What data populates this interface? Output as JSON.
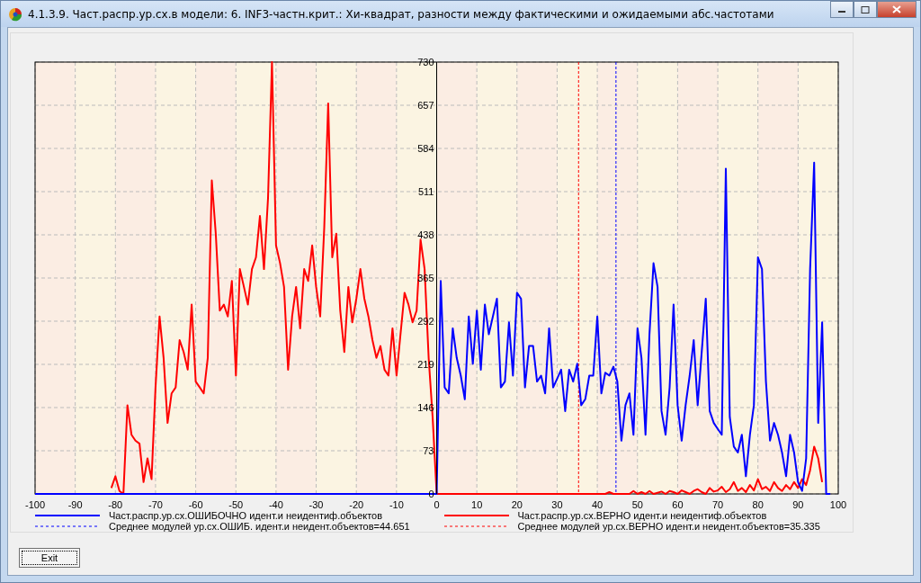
{
  "window": {
    "title": "4.1.3.9. Част.распр.ур.сх.в модели: 6. INF3-частн.крит.: Хи-квадрат, разности между фактическими и ожидаемыми абс.частотами"
  },
  "chart_data": {
    "type": "line",
    "xlim": [
      -100,
      100
    ],
    "ylim": [
      0,
      730
    ],
    "xticks": [
      -100,
      -90,
      -80,
      -70,
      -60,
      -50,
      -40,
      -30,
      -20,
      -10,
      0,
      10,
      20,
      30,
      40,
      50,
      60,
      70,
      80,
      90,
      100
    ],
    "yticks": [
      0,
      73,
      146,
      219,
      292,
      365,
      438,
      511,
      584,
      657,
      730
    ],
    "x": [
      -100,
      -99,
      -98,
      -97,
      -96,
      -95,
      -94,
      -93,
      -92,
      -91,
      -90,
      -89,
      -88,
      -87,
      -86,
      -85,
      -84,
      -83,
      -82,
      -81,
      -80,
      -79,
      -78,
      -77,
      -76,
      -75,
      -74,
      -73,
      -72,
      -71,
      -70,
      -69,
      -68,
      -67,
      -66,
      -65,
      -64,
      -63,
      -62,
      -61,
      -60,
      -59,
      -58,
      -57,
      -56,
      -55,
      -54,
      -53,
      -52,
      -51,
      -50,
      -49,
      -48,
      -47,
      -46,
      -45,
      -44,
      -43,
      -42,
      -41,
      -40,
      -39,
      -38,
      -37,
      -36,
      -35,
      -34,
      -33,
      -32,
      -31,
      -30,
      -29,
      -28,
      -27,
      -26,
      -25,
      -24,
      -23,
      -22,
      -21,
      -20,
      -19,
      -18,
      -17,
      -16,
      -15,
      -14,
      -13,
      -12,
      -11,
      -10,
      -9,
      -8,
      -7,
      -6,
      -5,
      -4,
      -3,
      -2,
      -1,
      0,
      1,
      2,
      3,
      4,
      5,
      6,
      7,
      8,
      9,
      10,
      11,
      12,
      13,
      14,
      15,
      16,
      17,
      18,
      19,
      20,
      21,
      22,
      23,
      24,
      25,
      26,
      27,
      28,
      29,
      30,
      31,
      32,
      33,
      34,
      35,
      36,
      37,
      38,
      39,
      40,
      41,
      42,
      43,
      44,
      45,
      46,
      47,
      48,
      49,
      50,
      51,
      52,
      53,
      54,
      55,
      56,
      57,
      58,
      59,
      60,
      61,
      62,
      63,
      64,
      65,
      66,
      67,
      68,
      69,
      70,
      71,
      72,
      73,
      74,
      75,
      76,
      77,
      78,
      79,
      80,
      81,
      82,
      83,
      84,
      85,
      86,
      87,
      88,
      89,
      90,
      91,
      92,
      93,
      94,
      95,
      96,
      97,
      98
    ],
    "series": [
      {
        "name": "Част.распр.ур.сх.ОШИБОЧНО идент.и неидентиф.объектов",
        "color": "#0000ff",
        "values": [
          0,
          0,
          0,
          0,
          0,
          0,
          0,
          0,
          0,
          0,
          0,
          0,
          0,
          0,
          0,
          0,
          0,
          0,
          0,
          0,
          0,
          0,
          0,
          0,
          0,
          0,
          0,
          0,
          0,
          0,
          0,
          0,
          0,
          0,
          0,
          0,
          0,
          0,
          0,
          0,
          0,
          0,
          0,
          0,
          0,
          0,
          0,
          0,
          0,
          0,
          0,
          0,
          0,
          0,
          0,
          0,
          0,
          0,
          0,
          0,
          0,
          0,
          0,
          0,
          0,
          0,
          0,
          0,
          0,
          0,
          0,
          0,
          0,
          0,
          0,
          0,
          0,
          0,
          0,
          0,
          0,
          0,
          0,
          0,
          0,
          0,
          0,
          0,
          0,
          0,
          0,
          0,
          0,
          0,
          0,
          0,
          0,
          0,
          0,
          0,
          0,
          360,
          180,
          170,
          280,
          230,
          200,
          160,
          300,
          220,
          310,
          210,
          320,
          270,
          300,
          330,
          180,
          190,
          290,
          200,
          340,
          330,
          180,
          250,
          250,
          190,
          200,
          170,
          280,
          180,
          195,
          210,
          140,
          210,
          190,
          220,
          150,
          160,
          200,
          200,
          300,
          170,
          205,
          200,
          215,
          190,
          90,
          150,
          170,
          100,
          280,
          230,
          100,
          270,
          390,
          350,
          140,
          100,
          180,
          320,
          150,
          90,
          150,
          200,
          260,
          150,
          240,
          330,
          140,
          120,
          110,
          100,
          550,
          130,
          80,
          70,
          100,
          30,
          100,
          150,
          400,
          380,
          190,
          90,
          120,
          100,
          70,
          30,
          100,
          70,
          20,
          5,
          60,
          380,
          560,
          120,
          290,
          0,
          0
        ]
      },
      {
        "name": "Част.распр.ур.сх.ВЕРНО идент.и неидентиф.объектов",
        "color": "#ff0000",
        "values": [
          null,
          null,
          null,
          null,
          null,
          null,
          null,
          null,
          null,
          null,
          null,
          null,
          null,
          null,
          null,
          null,
          null,
          null,
          null,
          10,
          30,
          5,
          0,
          150,
          100,
          90,
          85,
          20,
          60,
          25,
          180,
          300,
          230,
          120,
          170,
          180,
          260,
          240,
          210,
          320,
          190,
          180,
          170,
          230,
          530,
          440,
          310,
          320,
          300,
          360,
          200,
          380,
          350,
          320,
          380,
          400,
          470,
          380,
          500,
          730,
          420,
          390,
          350,
          210,
          300,
          350,
          280,
          380,
          360,
          420,
          350,
          300,
          450,
          660,
          400,
          440,
          310,
          240,
          350,
          290,
          330,
          380,
          330,
          300,
          260,
          230,
          250,
          210,
          200,
          280,
          200,
          270,
          340,
          320,
          290,
          310,
          430,
          380,
          230,
          130,
          0,
          0,
          0,
          0,
          0,
          0,
          0,
          0,
          0,
          0,
          0,
          0,
          0,
          0,
          0,
          0,
          0,
          0,
          0,
          0,
          0,
          0,
          0,
          0,
          0,
          0,
          0,
          0,
          0,
          0,
          0,
          0,
          0,
          0,
          0,
          0,
          0,
          0,
          0,
          0,
          0,
          0,
          0,
          3,
          0,
          0,
          0,
          0,
          0,
          5,
          0,
          3,
          0,
          5,
          0,
          2,
          4,
          0,
          5,
          3,
          0,
          6,
          3,
          0,
          5,
          8,
          3,
          0,
          10,
          4,
          6,
          12,
          3,
          8,
          20,
          5,
          10,
          3,
          15,
          6,
          25,
          8,
          12,
          5,
          20,
          10,
          5,
          15,
          8,
          20,
          10,
          25,
          15,
          40,
          80,
          60,
          20,
          null,
          null
        ]
      }
    ],
    "grid": true,
    "ref_lines": [
      {
        "axis": "x",
        "value": 44.651,
        "color": "#0000ff",
        "label": "Среднее модулей ур.сх.ОШИБ. идент.и неидент.объектов=44.651"
      },
      {
        "axis": "x",
        "value": 35.335,
        "color": "#ff0000",
        "label": "Среднее модулей ур.сх.ВЕРНО идент.и неидент.объектов=35.335"
      }
    ]
  },
  "buttons": {
    "exit": "Exit"
  }
}
